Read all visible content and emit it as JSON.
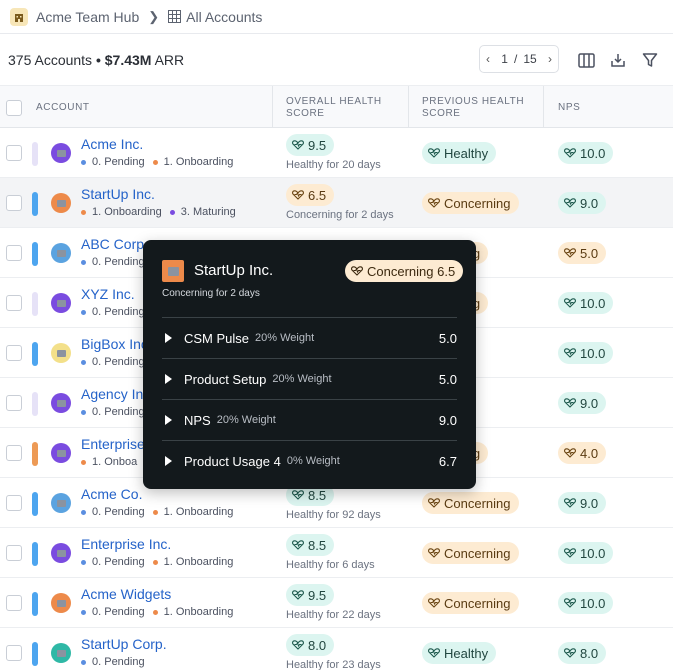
{
  "breadcrumb": {
    "app": "Acme Team Hub",
    "current": "All Accounts"
  },
  "summary": {
    "count": "375 Accounts",
    "sep": " • ",
    "arr": "$7.43M",
    "arr_label": " ARR"
  },
  "pager": {
    "page": "1",
    "sep": "/",
    "total": "15"
  },
  "icons": [
    "building-icon",
    "chevron-right-icon",
    "grid-icon",
    "columns-icon",
    "download-icon",
    "filter-icon",
    "health-icon"
  ],
  "columns": {
    "account": "ACCOUNT",
    "overall": "OVERALL HEALTH SCORE",
    "previous": "PREVIOUS HEALTH SCORE",
    "nps": "NPS"
  },
  "colors": {
    "link": "#2563c9",
    "teal_pill": "#dcf5f0",
    "orange_pill": "#fdebd2",
    "tooltip_bg": "#13191c"
  },
  "rows": [
    {
      "name": "Acme Inc.",
      "stage1": "0. Pending",
      "stage2": "1. Onboarding",
      "score": "9.5",
      "days": "Healthy for 20 days",
      "previous": "Healthy",
      "nps": "10.0"
    },
    {
      "name": "StartUp Inc.",
      "stage1": "1. Onboarding",
      "stage2": "3. Maturing",
      "score": "6.5",
      "days": "Concerning for 2 days",
      "previous": "Concerning",
      "nps": "9.0"
    },
    {
      "name": "ABC Corp",
      "stage1": "0. Pending",
      "previous": "erning",
      "nps": "5.0"
    },
    {
      "name": "XYZ Inc.",
      "stage1": "0. Pending",
      "previous": "erning",
      "nps": "10.0"
    },
    {
      "name": "BigBox Inc",
      "stage1": "0. Pending",
      "previous": "hy",
      "nps": "10.0"
    },
    {
      "name": "Agency In",
      "stage1": "0. Pending",
      "previous": "hy",
      "nps": "9.0"
    },
    {
      "name": "Enterprise",
      "stage1": "1. Onboa",
      "previous": "erning",
      "nps": "4.0"
    },
    {
      "name": "Acme Co.",
      "stage1": "0. Pending",
      "stage2": "1. Onboarding",
      "score": "8.5",
      "days": "Healthy for 92 days",
      "previous": "Concerning",
      "nps": "9.0"
    },
    {
      "name": "Enterprise Inc.",
      "stage1": "0. Pending",
      "stage2": "1. Onboarding",
      "score": "8.5",
      "days": "Healthy for 6 days",
      "previous": "Concerning",
      "nps": "10.0"
    },
    {
      "name": "Acme Widgets",
      "stage1": "0. Pending",
      "stage2": "1. Onboarding",
      "score": "9.5",
      "days": "Healthy for 22 days",
      "previous": "Concerning",
      "nps": "10.0"
    },
    {
      "name": "StartUp Corp.",
      "stage1": "0. Pending",
      "score": "8.0",
      "days": "Healthy for 23 days",
      "previous": "Healthy",
      "nps": "8.0"
    }
  ],
  "tooltip": {
    "name": "StartUp Inc.",
    "sub": "Concerning for 2 days",
    "badge": "Concerning 6.5",
    "items": [
      {
        "label": "CSM Pulse",
        "weight": "20% Weight",
        "value": "5.0"
      },
      {
        "label": "Product Setup",
        "weight": "20% Weight",
        "value": "5.0"
      },
      {
        "label": "NPS",
        "weight": "20% Weight",
        "value": "9.0"
      },
      {
        "label": "Product Usage 4",
        "weight": "0% Weight",
        "value": "6.7"
      }
    ]
  }
}
